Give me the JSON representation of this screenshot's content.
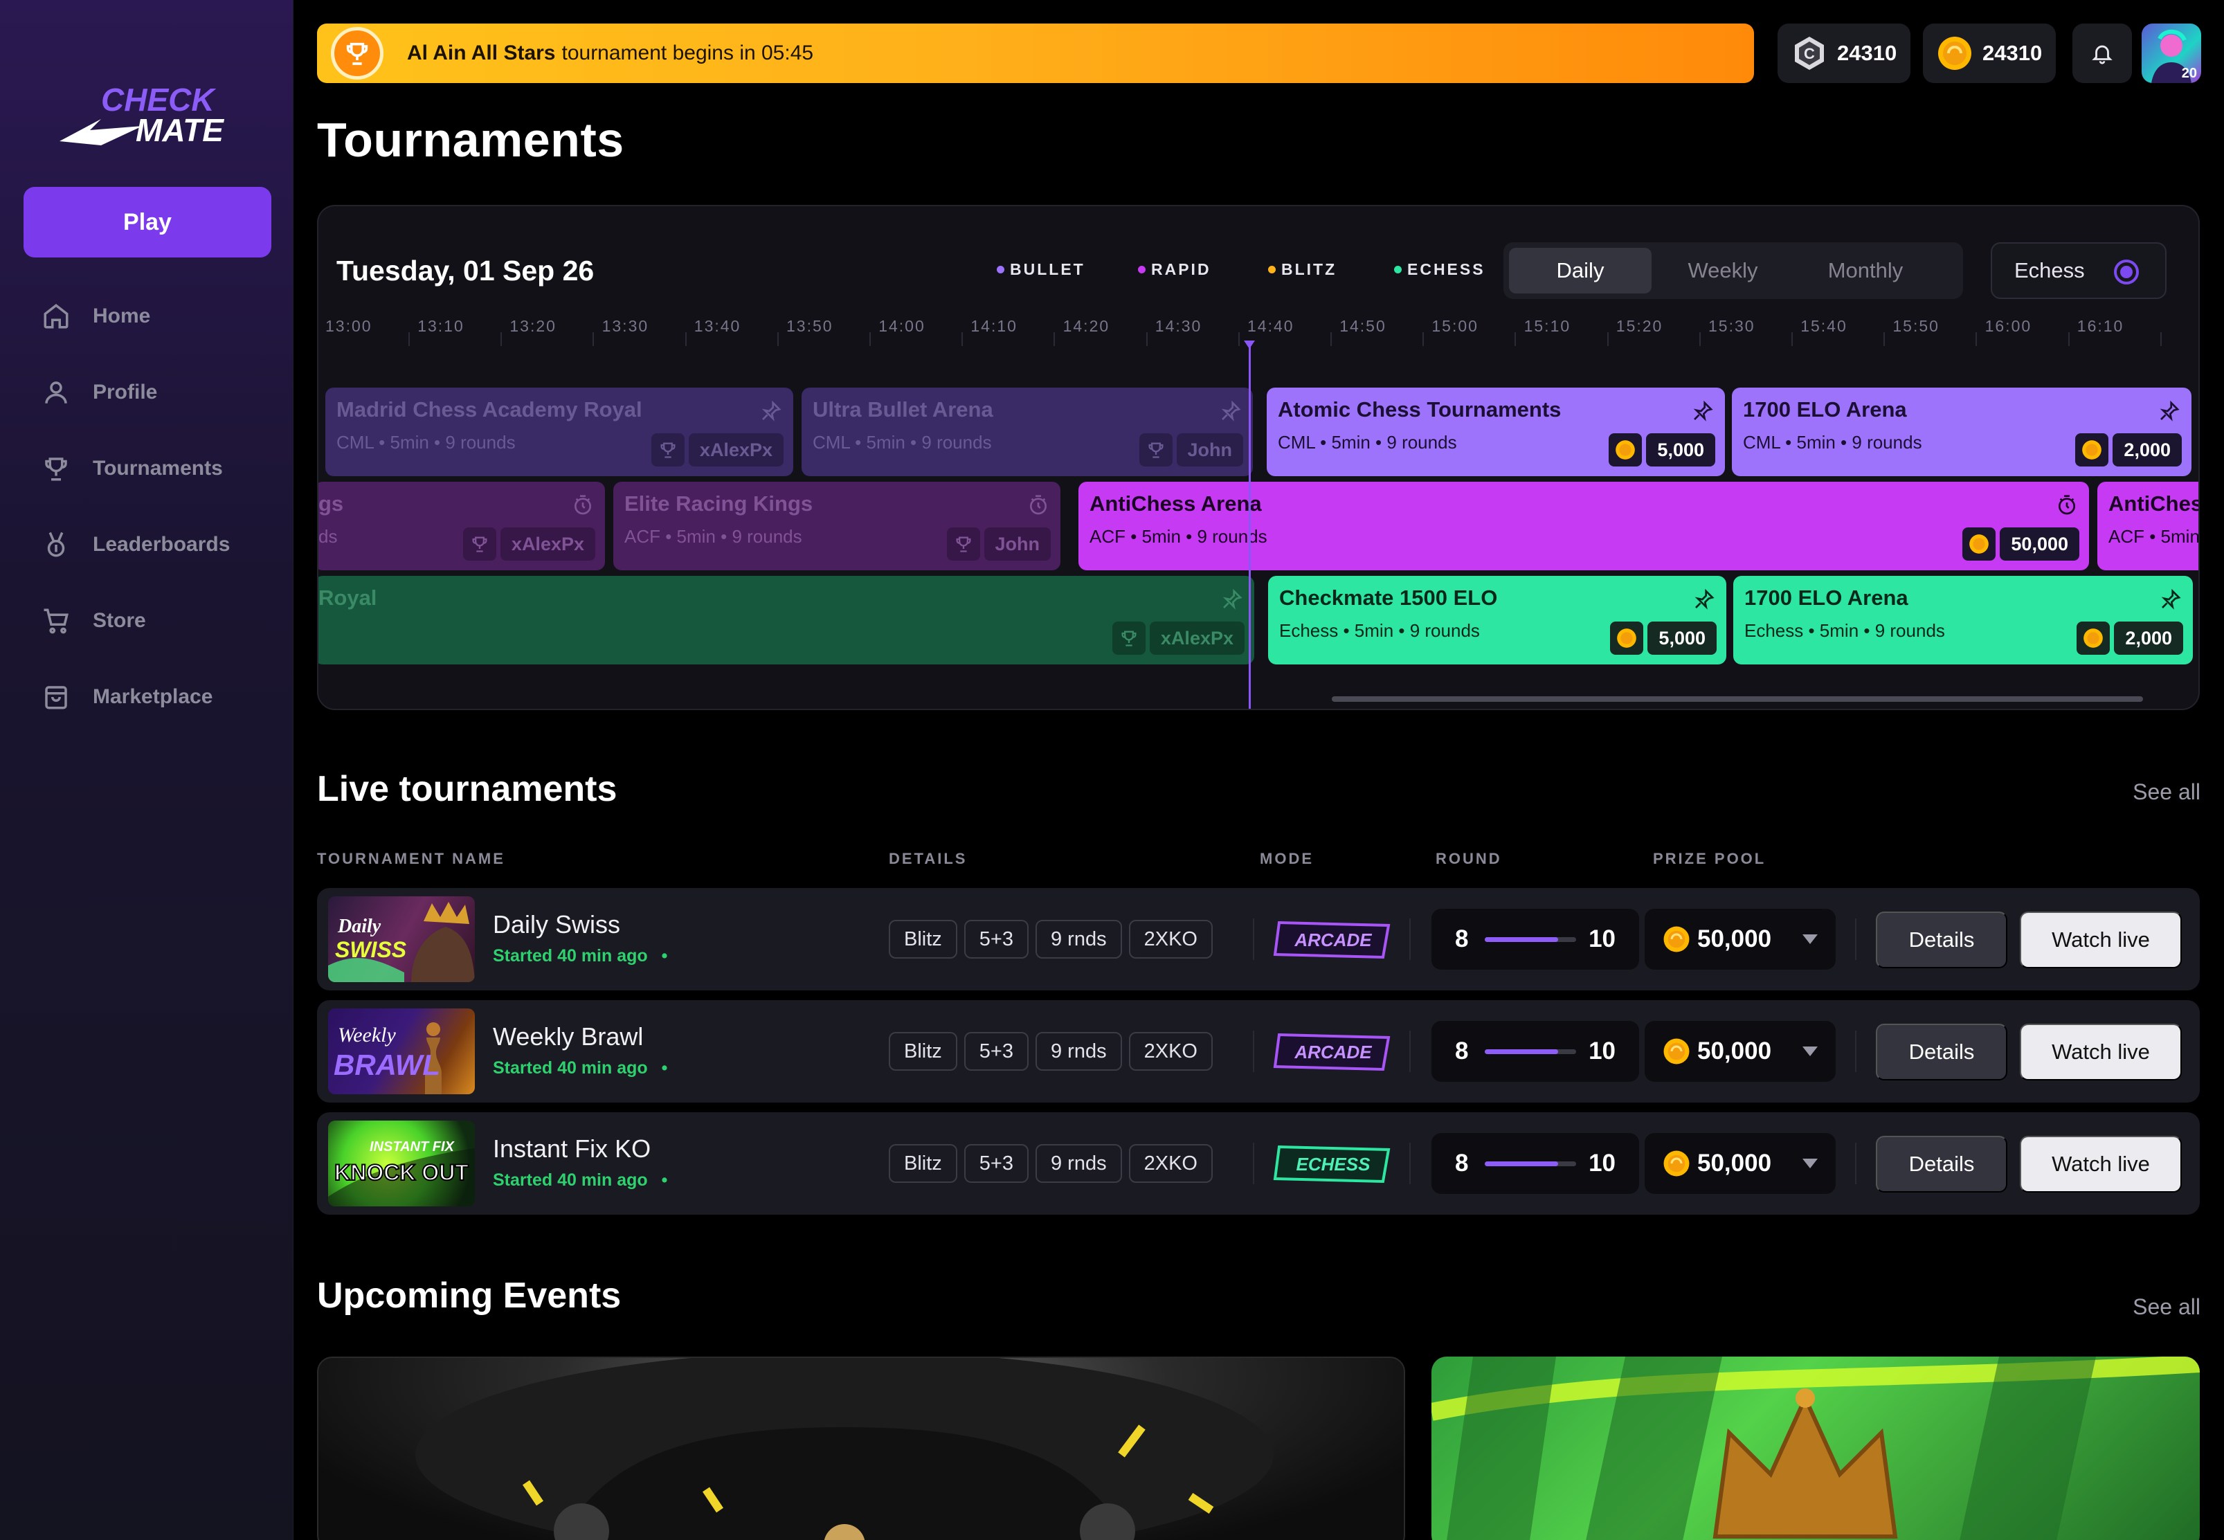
{
  "app": {
    "logo_line1": "CHECK",
    "logo_line2": "MATE"
  },
  "sidebar": {
    "play_label": "Play",
    "items": [
      {
        "label": "Home",
        "icon": "home-icon"
      },
      {
        "label": "Profile",
        "icon": "user-icon"
      },
      {
        "label": "Tournaments",
        "icon": "trophy-icon"
      },
      {
        "label": "Leaderboards",
        "icon": "medal-icon"
      },
      {
        "label": "Store",
        "icon": "cart-icon"
      },
      {
        "label": "Marketplace",
        "icon": "bag-icon"
      }
    ]
  },
  "banner": {
    "bold": "Al Ain All Stars",
    "rest": "tournament begins in 05:45"
  },
  "wallet": {
    "silver": "24310",
    "gold": "24310"
  },
  "avatar_level": "20",
  "page_title": "Tournaments",
  "schedule": {
    "date": "Tuesday, 01 Sep 26",
    "legend": [
      {
        "label": "BULLET",
        "color": "#9d73fb"
      },
      {
        "label": "RAPID",
        "color": "#c63af3"
      },
      {
        "label": "BLITZ",
        "color": "#ffb21a"
      },
      {
        "label": "ECHESS",
        "color": "#2de6a1"
      }
    ],
    "periods": [
      "Daily",
      "Weekly",
      "Monthly"
    ],
    "active_period": "Daily",
    "echess_toggle": "Echess",
    "ticks": [
      "13:00",
      "13:10",
      "13:20",
      "13:30",
      "13:40",
      "13:50",
      "14:00",
      "14:10",
      "14:20",
      "14:30",
      "14:40",
      "14:50",
      "15:00",
      "15:10",
      "15:20",
      "15:30",
      "15:40",
      "15:50",
      "16:00",
      "16:10"
    ],
    "events": [
      {
        "title": "Madrid Chess Academy Royal",
        "sub": "CML • 5min • 9 rounds",
        "tag": "xAlexPx",
        "tag_kind": "trophy"
      },
      {
        "title": "Ultra Bullet Arena",
        "sub": "CML • 5min • 9 rounds",
        "tag": "John",
        "tag_kind": "trophy"
      },
      {
        "title": "Atomic Chess Tournaments",
        "sub": "CML • 5min • 9 rounds",
        "tag": "5,000",
        "tag_kind": "coin"
      },
      {
        "title": "1700 ELO Arena",
        "sub": "CML • 5min • 9 rounds",
        "tag": "2,000",
        "tag_kind": "coin"
      },
      {
        "title": "gs",
        "sub": "ds",
        "tag": "xAlexPx",
        "tag_kind": "trophy"
      },
      {
        "title": "Elite Racing Kings",
        "sub": "ACF • 5min • 9 rounds",
        "tag": "John",
        "tag_kind": "trophy"
      },
      {
        "title": "AntiChess Arena",
        "sub": "ACF • 5min • 9 rounds",
        "tag": "50,000",
        "tag_kind": "coin"
      },
      {
        "title": "AntiChess",
        "sub": "ACF • 5min",
        "tag": "",
        "tag_kind": "none"
      },
      {
        "title": "Royal",
        "sub": "",
        "tag": "xAlexPx",
        "tag_kind": "trophy"
      },
      {
        "title": "Checkmate 1500 ELO",
        "sub": "Echess • 5min • 9 rounds",
        "tag": "5,000",
        "tag_kind": "coin"
      },
      {
        "title": "1700 ELO Arena",
        "sub": "Echess • 5min • 9 rounds",
        "tag": "2,000",
        "tag_kind": "coin"
      }
    ]
  },
  "live": {
    "title": "Live tournaments",
    "see_all": "See all",
    "columns": [
      "TOURNAMENT NAME",
      "DETAILS",
      "MODE",
      "ROUND",
      "PRIZE POOL"
    ],
    "rows": [
      {
        "name": "Daily Swiss",
        "status": "Started 40 min ago",
        "pills": [
          "Blitz",
          "5+3",
          "9 rnds",
          "2XKO"
        ],
        "mode": "ARCADE",
        "round_current": "8",
        "round_total": "10",
        "round_progress": 0.8,
        "prize": "50,000",
        "details": "Details",
        "watch": "Watch live",
        "thumb_text": [
          "Daily",
          "SWISS"
        ]
      },
      {
        "name": "Weekly Brawl",
        "status": "Started 40 min ago",
        "pills": [
          "Blitz",
          "5+3",
          "9 rnds",
          "2XKO"
        ],
        "mode": "ARCADE",
        "round_current": "8",
        "round_total": "10",
        "round_progress": 0.8,
        "prize": "50,000",
        "details": "Details",
        "watch": "Watch live",
        "thumb_text": [
          "Weekly",
          "BRAWL"
        ]
      },
      {
        "name": "Instant Fix KO",
        "status": "Started 40 min ago",
        "pills": [
          "Blitz",
          "5+3",
          "9 rnds",
          "2XKO"
        ],
        "mode": "ECHESS",
        "round_current": "8",
        "round_total": "10",
        "round_progress": 0.8,
        "prize": "50,000",
        "details": "Details",
        "watch": "Watch live",
        "thumb_text": [
          "INSTANT FIX",
          "KNOCK OUT"
        ]
      }
    ]
  },
  "upcoming": {
    "title": "Upcoming Events",
    "see_all": "See all"
  }
}
